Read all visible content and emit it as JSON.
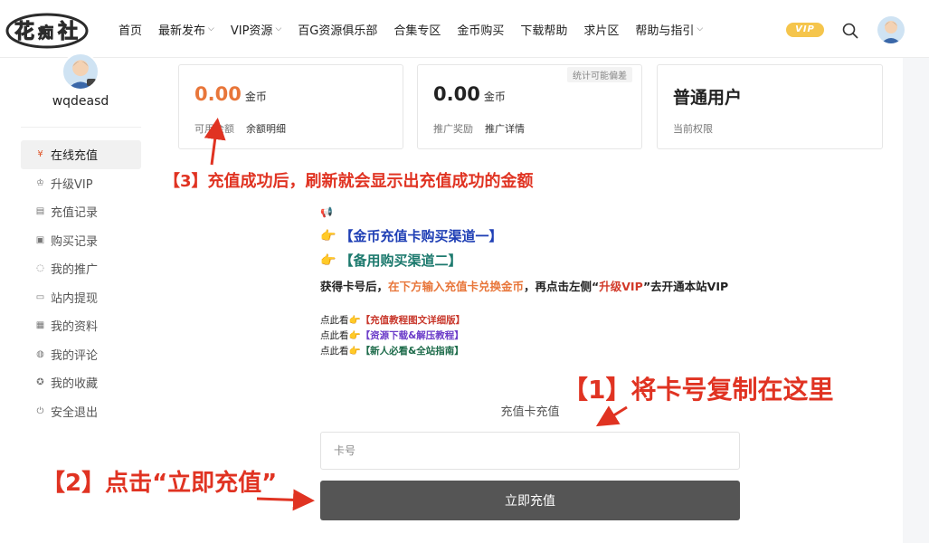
{
  "nav": {
    "logo_text": "花痴社",
    "items": [
      {
        "label": "首页",
        "dropdown": false
      },
      {
        "label": "最新发布",
        "dropdown": true
      },
      {
        "label": "VIP资源",
        "dropdown": true
      },
      {
        "label": "百G资源俱乐部",
        "dropdown": false
      },
      {
        "label": "合集专区",
        "dropdown": false
      },
      {
        "label": "金币购买",
        "dropdown": false
      },
      {
        "label": "下载帮助",
        "dropdown": false
      },
      {
        "label": "求片区",
        "dropdown": false
      },
      {
        "label": "帮助与指引",
        "dropdown": true
      }
    ],
    "vip_label": "VIP"
  },
  "sidebar": {
    "username": "wqdeasd",
    "items": [
      {
        "label": "在线充值",
        "icon": "yen-icon",
        "glyph": "¥",
        "active": true
      },
      {
        "label": "升级VIP",
        "icon": "crown-icon",
        "glyph": "♔",
        "active": false
      },
      {
        "label": "充值记录",
        "icon": "card-icon",
        "glyph": "▤",
        "active": false
      },
      {
        "label": "购买记录",
        "icon": "bag-icon",
        "glyph": "▣",
        "active": false
      },
      {
        "label": "我的推广",
        "icon": "share-icon",
        "glyph": "◌",
        "active": false
      },
      {
        "label": "站内提现",
        "icon": "wallet-icon",
        "glyph": "▭",
        "active": false
      },
      {
        "label": "我的资料",
        "icon": "profile-icon",
        "glyph": "▦",
        "active": false
      },
      {
        "label": "我的评论",
        "icon": "comment-icon",
        "glyph": "◍",
        "active": false
      },
      {
        "label": "我的收藏",
        "icon": "star-icon",
        "glyph": "✪",
        "active": false
      },
      {
        "label": "安全退出",
        "icon": "power-icon",
        "glyph": "⏻",
        "active": false
      }
    ]
  },
  "stats": {
    "balance": {
      "value": "0.00",
      "unit": "金币",
      "label": "可用余额",
      "link": "余额明细"
    },
    "promo": {
      "value": "0.00",
      "unit": "金币",
      "label": "推广奖励",
      "link": "推广详情",
      "tag": "统计可能偏差"
    },
    "permission": {
      "title": "普通用户",
      "label": "当前权限"
    }
  },
  "notice": {
    "link1": "【金币充值卡购买渠道一】",
    "link2": "【备用购买渠道二】",
    "instr_a": "获得卡号后，",
    "instr_b": "在下方输入充值卡兑换金币",
    "instr_c": "，再点击左侧“",
    "instr_d": "升级VIP",
    "instr_e": "”去开通本站VIP",
    "see": "点此看",
    "tutorial1": "【充值教程图文详细版】",
    "tutorial2": "【资源下载&解压教程】",
    "tutorial3": "【新人必看&全站指南】"
  },
  "recharge": {
    "label": "充值卡充值",
    "placeholder": "卡号",
    "button": "立即充值"
  },
  "annotations": {
    "step3": "【3】充值成功后，刷新就会显示出充值成功的金额",
    "step1": "【1】将卡号复制在这里",
    "step2": "【2】点击“立即充值”"
  },
  "colors": {
    "accent_orange": "#e8763a",
    "annotation_red": "#e03322",
    "vip_gold": "#f5c54c",
    "button_gray": "#555555"
  }
}
